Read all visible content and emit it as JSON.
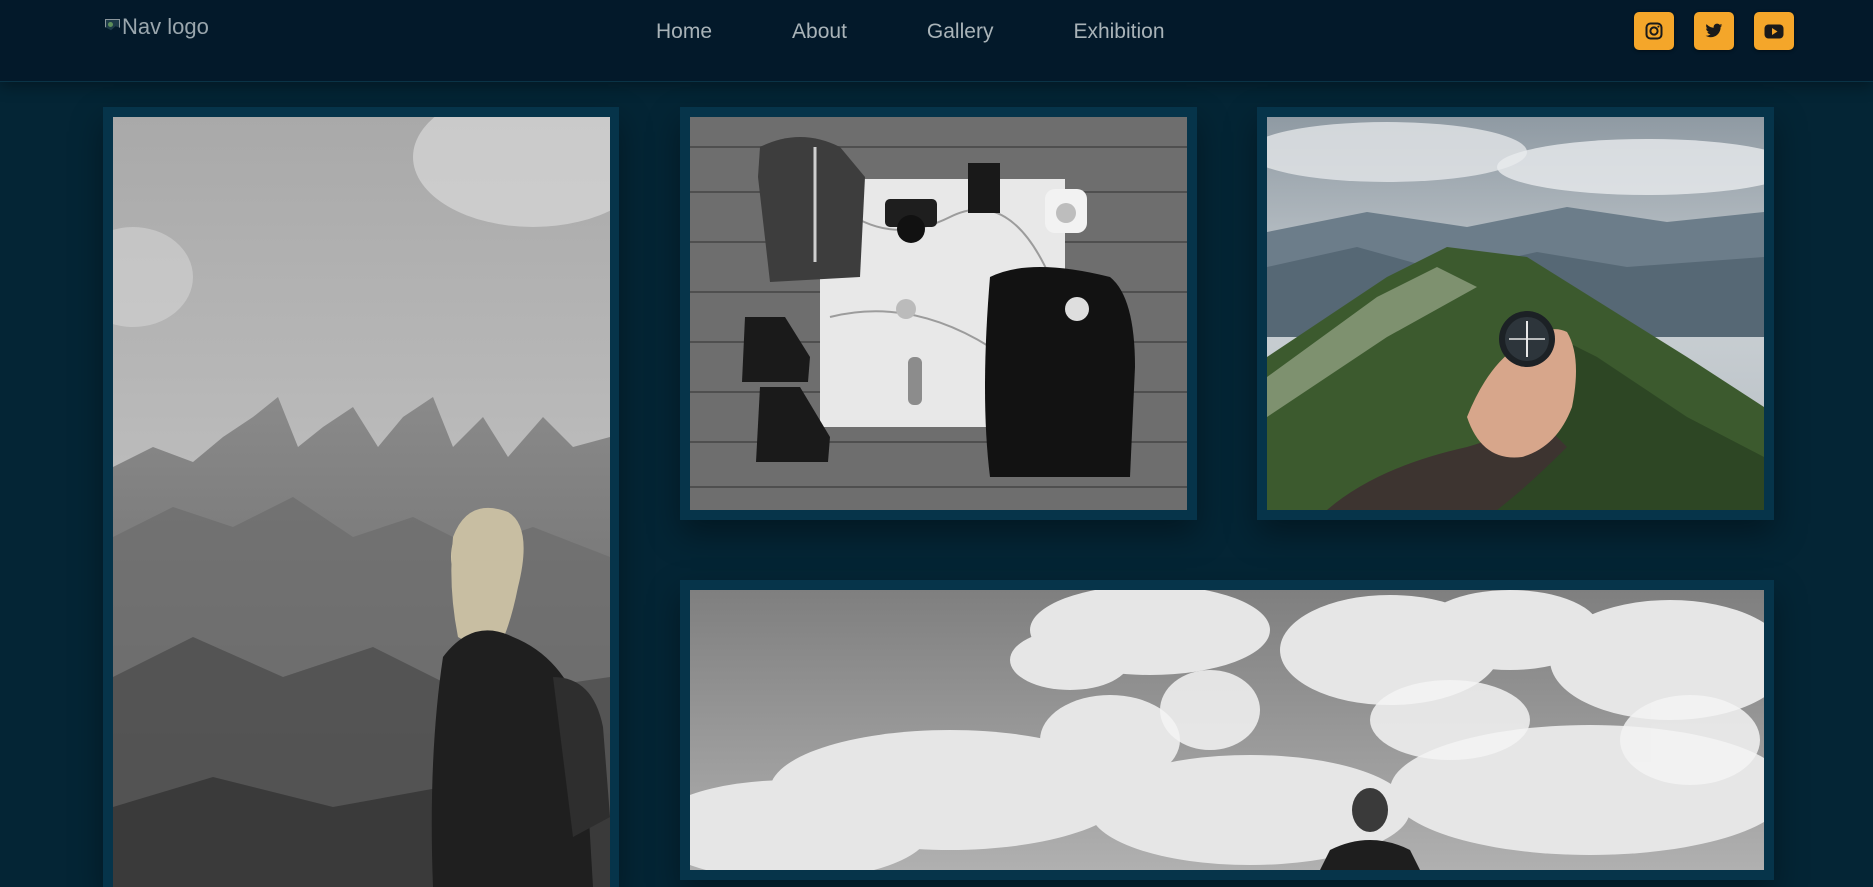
{
  "nav": {
    "logo_alt": "Nav logo",
    "items": [
      {
        "label": "Home"
      },
      {
        "label": "About"
      },
      {
        "label": "Gallery"
      },
      {
        "label": "Exhibition"
      }
    ],
    "social": [
      {
        "icon": "instagram-icon"
      },
      {
        "icon": "twitter-icon"
      },
      {
        "icon": "youtube-icon"
      }
    ]
  },
  "colors": {
    "background": "#042535",
    "nav_background": "#03192a",
    "frame": "#06344a",
    "nav_text": "#a9b3b8",
    "social_accent": "#f4a62a"
  },
  "gallery": [
    {
      "subject": "woman-mountains-photo"
    },
    {
      "subject": "travel-gear-flatlay-photo"
    },
    {
      "subject": "compass-mountain-photo"
    },
    {
      "subject": "hiker-clouds-photo"
    }
  ]
}
